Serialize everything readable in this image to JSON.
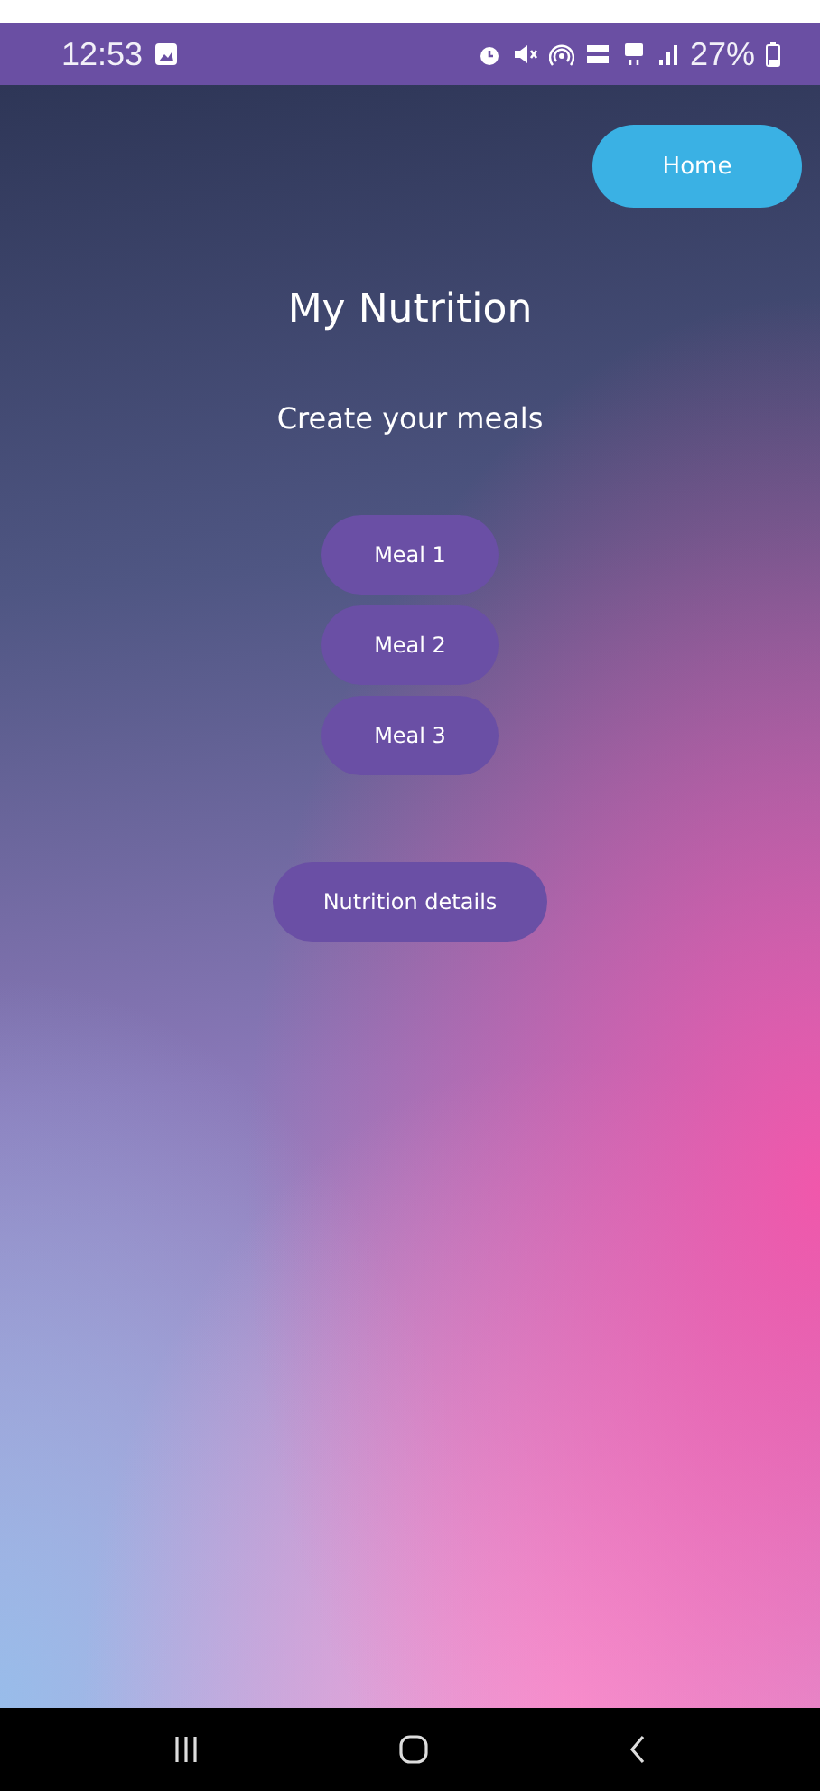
{
  "status_bar": {
    "time": "12:53",
    "battery": "27%"
  },
  "home_button": {
    "label": "Home"
  },
  "title": "My Nutrition",
  "subtitle": "Create your meals",
  "meals": [
    {
      "label": "Meal 1"
    },
    {
      "label": "Meal 2"
    },
    {
      "label": "Meal 3"
    }
  ],
  "details_button": {
    "label": "Nutrition details"
  }
}
